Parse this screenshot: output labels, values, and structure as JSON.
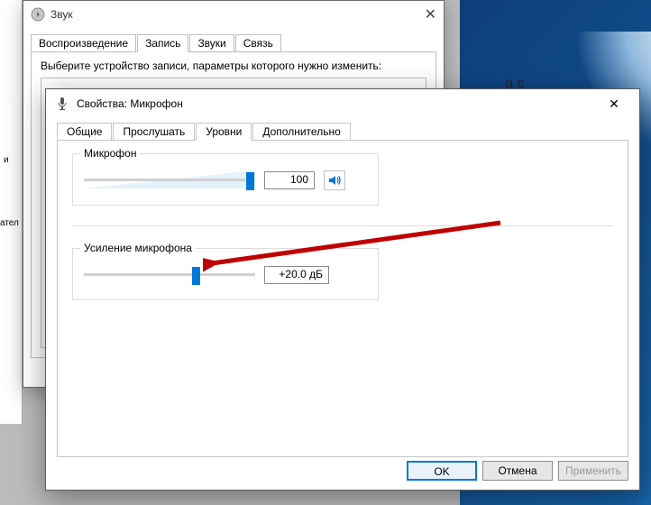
{
  "background": {
    "text_fragment_1": "а с",
    "left_fragment_1": "и",
    "left_fragment_2": "ател"
  },
  "sound_window": {
    "title": "Звук",
    "tabs": [
      "Воспроизведение",
      "Запись",
      "Звуки",
      "Связь"
    ],
    "active_tab_index": 1,
    "panel_hint": "Выберите устройство записи, параметры которого нужно изменить:"
  },
  "prop_window": {
    "title": "Свойства: Микрофон",
    "tabs": [
      "Общие",
      "Прослушать",
      "Уровни",
      "Дополнительно"
    ],
    "active_tab_index": 2,
    "mic_slider": {
      "label": "Микрофон",
      "value": "100"
    },
    "boost_slider": {
      "label": "Усиление микрофона",
      "value": "+20.0 дБ"
    },
    "buttons": {
      "ok": "OK",
      "cancel": "Отмена",
      "apply": "Применить"
    }
  }
}
